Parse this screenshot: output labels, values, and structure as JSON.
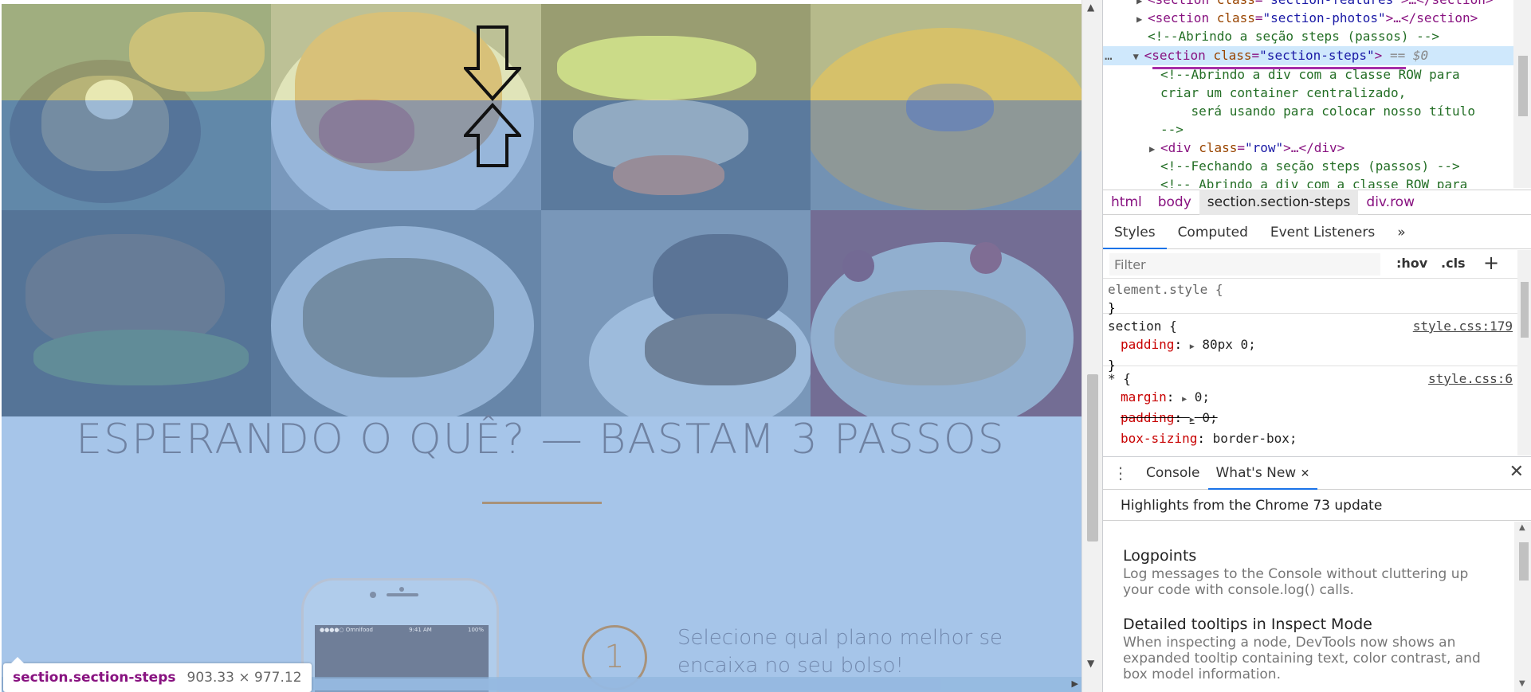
{
  "page": {
    "section_title": "ESPERANDO O QUÊ? — BASTAM 3 PASSOS",
    "step_number": "1",
    "step_text": "Selecione qual plano melhor se encaixa no seu bolso!",
    "phone_status": {
      "carrier": "●●●●○ Omnifood",
      "time": "9:41 AM",
      "battery": "100%"
    }
  },
  "tooltip": {
    "selector": "section.section-steps",
    "dimensions": "903.33 × 977.12"
  },
  "devtools": {
    "elements": [
      {
        "type": "element",
        "tri": "▶",
        "tag": "section",
        "attr_name": "class",
        "attr_value": "\"section-features\"",
        "tail": ">…</section>"
      },
      {
        "type": "element",
        "tri": "▶",
        "tag": "section",
        "attr_name": "class",
        "attr_value": "\"section-photos\"",
        "tail": ">…</section>"
      },
      {
        "type": "comment",
        "text": "<!--Abrindo a seção steps (passos) -->"
      },
      {
        "type": "element",
        "tri": "▼",
        "tag": "section",
        "attr_name": "class",
        "attr_value": "\"section-steps\"",
        "tail": ">",
        "selected": true,
        "marker": "== $0"
      },
      {
        "type": "comment",
        "text": "<!--Abrindo a div com a classe ROW para"
      },
      {
        "type": "comment",
        "text": "criar um container centralizado,"
      },
      {
        "type": "comment",
        "text": "    será usando para colocar nosso título"
      },
      {
        "type": "comment",
        "text": "-->"
      },
      {
        "type": "element",
        "tri": "▶",
        "tag": "div",
        "attr_name": "class",
        "attr_value": "\"row\"",
        "tail": ">…</div>"
      },
      {
        "type": "comment",
        "text": "<!--Fechando a seção steps (passos) -->"
      },
      {
        "type": "comment",
        "text": "<!-- Abrindo a div com a classe ROW para"
      }
    ],
    "dots": "…",
    "breadcrumbs": [
      "html",
      "body",
      "section.section-steps",
      "div.row"
    ],
    "style_tabs": [
      "Styles",
      "Computed",
      "Event Listeners"
    ],
    "more_tabs": "»",
    "filter_placeholder": "Filter",
    "hov_label": ":hov",
    "cls_label": ".cls",
    "add_rule_label": "+",
    "rules": {
      "element_style": {
        "selector": "element.style {",
        "close": "}"
      },
      "section": {
        "selector": "section {",
        "source": "style.css:179",
        "prop": "padding",
        "value": "80px 0;",
        "close": "}"
      },
      "universal": {
        "selector": "* {",
        "source": "style.css:6",
        "prop1": "margin",
        "value1": "0;",
        "prop2": "padding",
        "value2": "0;",
        "prop3": "box-sizing",
        "value3": "border-box;"
      }
    },
    "drawer_menu": "⋮",
    "drawer_tabs": [
      "Console",
      "What's New"
    ],
    "drawer_tab_close": "✕",
    "drawer_close": "✕",
    "whats_new_header": "Highlights from the Chrome 73 update",
    "whats_new_items": [
      {
        "title": "Logpoints",
        "desc": "Log messages to the Console without cluttering up your code with console.log() calls."
      },
      {
        "title": "Detailed tooltips in Inspect Mode",
        "desc": "When inspecting a node, DevTools now shows an expanded tooltip containing text, color contrast, and box model information."
      }
    ]
  },
  "colors": {
    "padding_overlay": "#e8eea0",
    "content_overlay": "#6fa2dc",
    "accent_brown": "#a8927a",
    "devtools_tag": "#881280",
    "devtools_selection": "#cfe8fc"
  }
}
